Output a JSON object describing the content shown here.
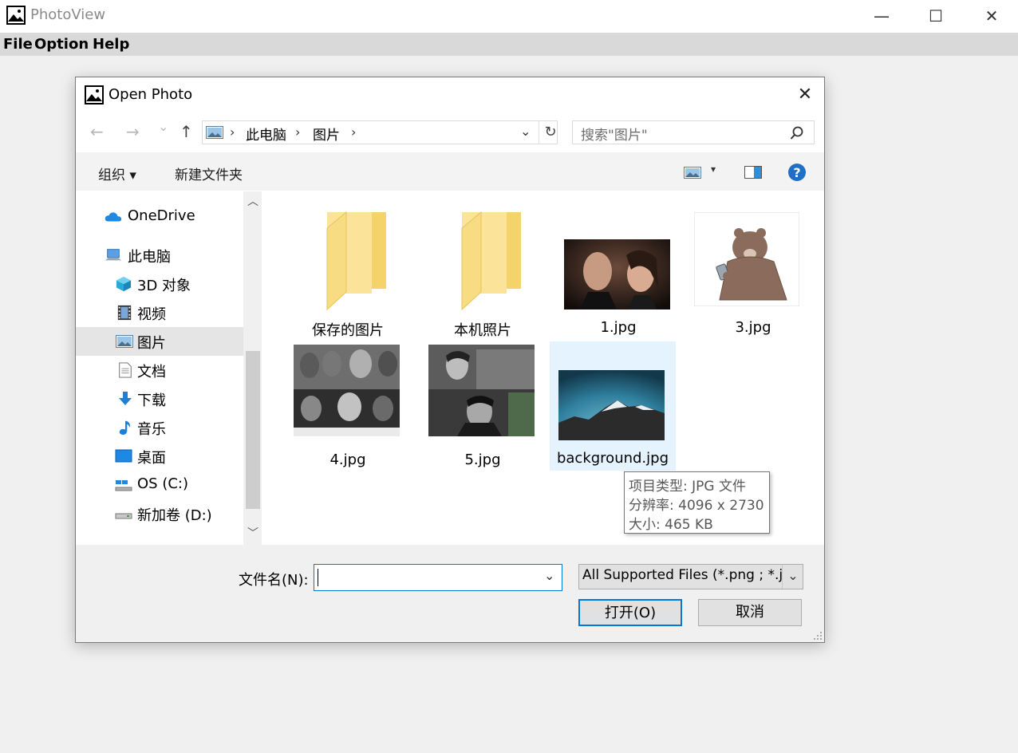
{
  "app": {
    "title": "PhotoView"
  },
  "window_controls": {
    "minimize": "—",
    "maximize": "☐",
    "close": "✕"
  },
  "menu": [
    "File",
    "Option",
    "Help"
  ],
  "dialog": {
    "title": "Open Photo",
    "close": "✕",
    "nav": {
      "back": "←",
      "forward": "→",
      "recent": "⌄",
      "up": "↑"
    },
    "breadcrumb": [
      "此电脑",
      "图片"
    ],
    "search_placeholder": "搜索\"图片\"",
    "toolbar": {
      "organize": "组织 ▾",
      "new_folder": "新建文件夹"
    },
    "sidebar": [
      {
        "label": "OneDrive",
        "icon": "cloud-icon",
        "selected": false
      },
      {
        "label": "此电脑",
        "icon": "computer-icon",
        "selected": false
      },
      {
        "label": "3D 对象",
        "icon": "cube-icon",
        "selected": false
      },
      {
        "label": "视频",
        "icon": "video-icon",
        "selected": false
      },
      {
        "label": "图片",
        "icon": "pictures-icon",
        "selected": true
      },
      {
        "label": "文档",
        "icon": "document-icon",
        "selected": false
      },
      {
        "label": "下载",
        "icon": "download-icon",
        "selected": false
      },
      {
        "label": "音乐",
        "icon": "music-icon",
        "selected": false
      },
      {
        "label": "桌面",
        "icon": "desktop-icon",
        "selected": false
      },
      {
        "label": "OS (C:)",
        "icon": "drive-c-icon",
        "selected": false
      },
      {
        "label": "新加卷 (D:)",
        "icon": "drive-d-icon",
        "selected": false
      }
    ],
    "files": [
      {
        "name": "保存的图片",
        "kind": "folder"
      },
      {
        "name": "本机照片",
        "kind": "folder"
      },
      {
        "name": "1.jpg",
        "kind": "image"
      },
      {
        "name": "3.jpg",
        "kind": "image"
      },
      {
        "name": "4.jpg",
        "kind": "image"
      },
      {
        "name": "5.jpg",
        "kind": "image"
      },
      {
        "name": "background.jpg",
        "kind": "image",
        "hovered": true
      }
    ],
    "tooltip": [
      "项目类型: JPG 文件",
      "分辨率: 4096 x 2730",
      "大小: 465 KB"
    ],
    "filename_label": "文件名(N):",
    "filename_value": "",
    "filter_value": "All Supported Files (*.png ; *.j",
    "open_button": "打开(O)",
    "cancel_button": "取消"
  },
  "colors": {
    "accent": "#0078d7",
    "selected_bg": "#e5e5e5",
    "hover_tile": "#e5f3ff",
    "folder": "#f7d57a"
  }
}
